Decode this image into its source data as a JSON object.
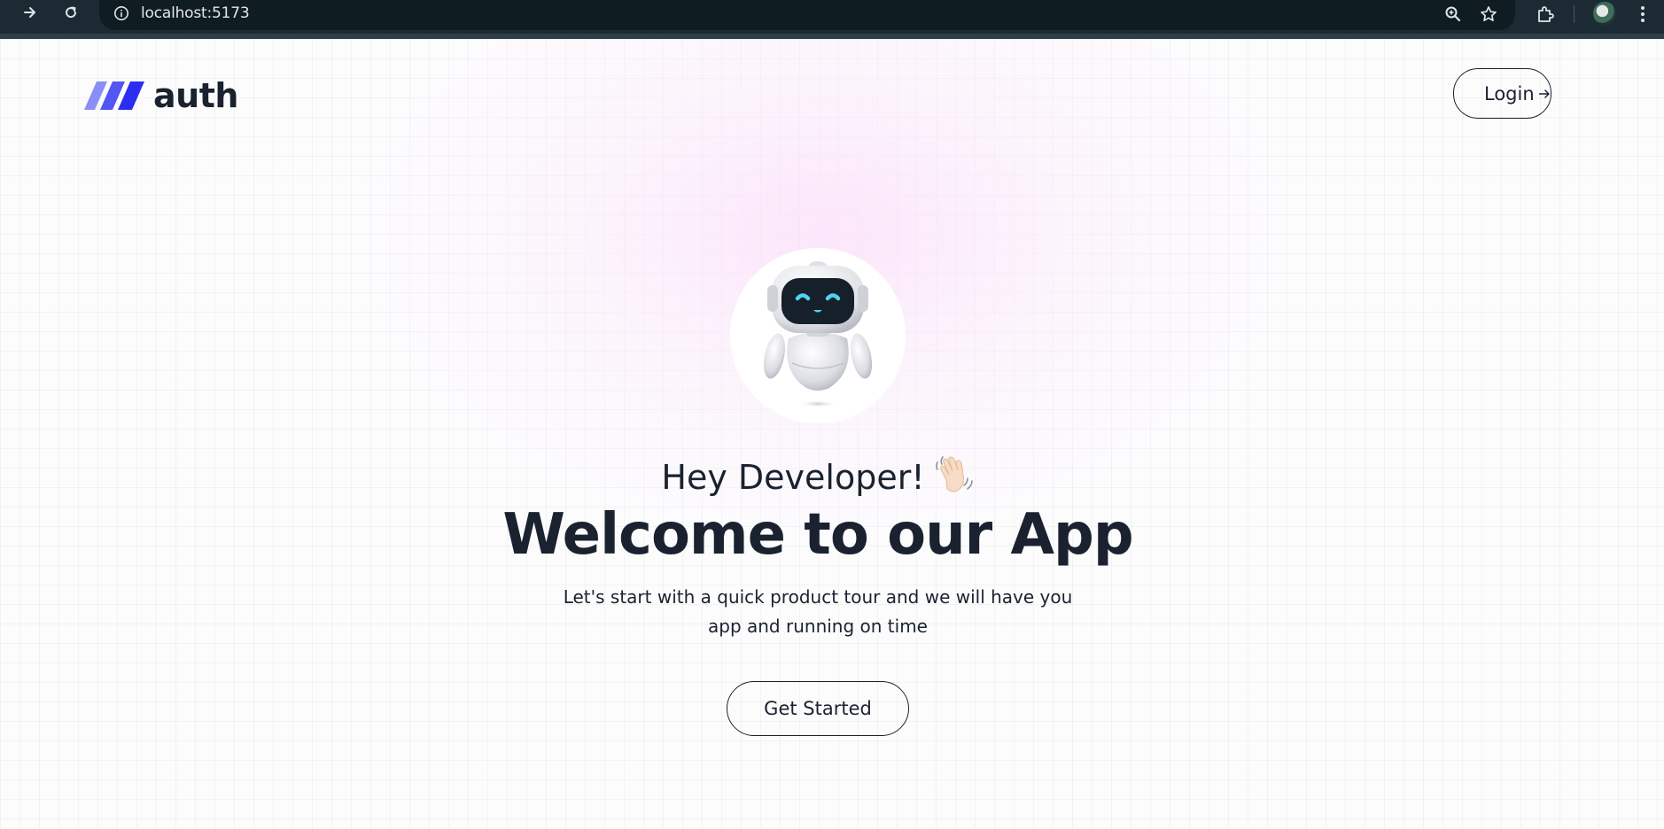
{
  "browser": {
    "url": "localhost:5173",
    "icons": [
      "forward-icon",
      "reload-icon",
      "site-info-icon",
      "zoom-icon",
      "bookmark-star-icon",
      "extensions-icon",
      "profile-avatar",
      "menu-icon"
    ]
  },
  "header": {
    "logo_text": "auth",
    "login_label": "Login"
  },
  "hero": {
    "greeting": "Hey Developer!",
    "title": "Welcome to our App",
    "subtitle": "Let's start with a quick product tour and we will have you app and running on time",
    "cta_label": "Get Started"
  },
  "colors": {
    "chrome_bg": "#1c2b33",
    "text": "#1a2230",
    "logo_light": "#8b8ef7",
    "logo_dark": "#2b2ef0",
    "glow": "#fcdefa"
  }
}
